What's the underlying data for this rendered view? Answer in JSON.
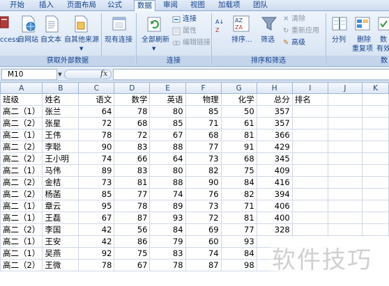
{
  "tabs": [
    "开始",
    "插入",
    "页面布局",
    "公式",
    "数据",
    "审阅",
    "视图",
    "加载项",
    "团队"
  ],
  "active_tab": "数据",
  "ribbon": {
    "external": {
      "access_label": "ccess",
      "web_label": "自网站",
      "text_label": "自文本",
      "other_label": "自其他来源",
      "existing_label": "现有连接",
      "group_label": "获取外部数据"
    },
    "connections": {
      "refresh_label": "全部刷新",
      "connections_label": "连接",
      "properties_label": "属性",
      "edit_links_label": "编辑链接",
      "group_label": "连接"
    },
    "sort_filter": {
      "sort_label": "排序...",
      "filter_label": "筛选",
      "clear_label": "清除",
      "reapply_label": "重新应用",
      "advanced_label": "高级",
      "group_label": "排序和筛选"
    },
    "data_tools": {
      "split_label": "分列",
      "remove_dup_label_1": "删除",
      "remove_dup_label_2": "重复项",
      "validation_label_1": "数",
      "validation_label_2": "有效",
      "group_label": "数"
    }
  },
  "formula_bar": {
    "name_box": "M10",
    "fx_label": "fx",
    "formula": ""
  },
  "columns": [
    "A",
    "B",
    "C",
    "D",
    "E",
    "F",
    "G",
    "H",
    "I",
    "J",
    "K"
  ],
  "table": {
    "headers": [
      "班级",
      "姓名",
      "语文",
      "数学",
      "英语",
      "物理",
      "化学",
      "总分",
      "排名"
    ],
    "rows": [
      [
        "高二（1）",
        "张兰",
        "64",
        "78",
        "80",
        "85",
        "50",
        "357",
        ""
      ],
      [
        "高二（2）",
        "张星",
        "72",
        "68",
        "85",
        "71",
        "61",
        "357",
        ""
      ],
      [
        "高二（1）",
        "王伟",
        "78",
        "72",
        "67",
        "68",
        "81",
        "366",
        ""
      ],
      [
        "高二（2）",
        "李聪",
        "90",
        "83",
        "88",
        "77",
        "91",
        "429",
        ""
      ],
      [
        "高二（2）",
        "王小明",
        "74",
        "66",
        "64",
        "73",
        "68",
        "345",
        ""
      ],
      [
        "高二（1）",
        "马伟",
        "89",
        "83",
        "80",
        "82",
        "75",
        "409",
        ""
      ],
      [
        "高二（2）",
        "金桔",
        "73",
        "81",
        "88",
        "90",
        "84",
        "416",
        ""
      ],
      [
        "高二（2）",
        "杨菡",
        "85",
        "77",
        "74",
        "76",
        "82",
        "394",
        ""
      ],
      [
        "高二（1）",
        "章云",
        "95",
        "78",
        "89",
        "73",
        "71",
        "406",
        ""
      ],
      [
        "高二（1）",
        "王磊",
        "67",
        "87",
        "93",
        "72",
        "81",
        "400",
        ""
      ],
      [
        "高二（2）",
        "李国",
        "42",
        "56",
        "84",
        "69",
        "77",
        "328",
        ""
      ],
      [
        "高二（1）",
        "王安",
        "42",
        "86",
        "79",
        "60",
        "93",
        "",
        ""
      ],
      [
        "高二（1）",
        "吴燕",
        "92",
        "75",
        "83",
        "74",
        "84",
        "",
        ""
      ],
      [
        "高二（2）",
        "王微",
        "78",
        "67",
        "78",
        "87",
        "98",
        "",
        ""
      ]
    ]
  },
  "watermark": "软件技巧",
  "colors": {
    "ribbon_text": "#15428b",
    "header_text": "#26476e",
    "gridline": "#d0d7e5"
  }
}
